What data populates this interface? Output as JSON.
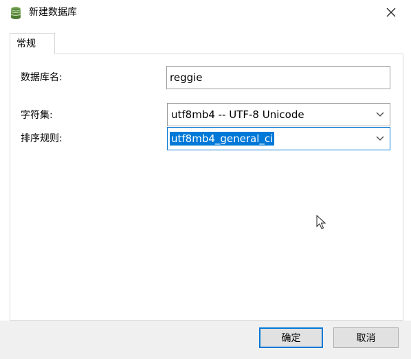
{
  "window": {
    "title": "新建数据库",
    "icon": "database-icon",
    "close_icon": "close-icon"
  },
  "tabs": [
    {
      "label": "常规",
      "active": true
    }
  ],
  "form": {
    "db_name": {
      "label": "数据库名:",
      "value": "reggie"
    },
    "charset": {
      "label": "字符集:",
      "value": "utf8mb4 -- UTF-8 Unicode"
    },
    "collation": {
      "label": "排序规则:",
      "value": "utf8mb4_general_ci"
    }
  },
  "buttons": {
    "ok": "确定",
    "cancel": "取消"
  },
  "colors": {
    "accent": "#0078d7",
    "icon_green": "#5a8a3c",
    "bottom_bar": "#f0f0f0"
  }
}
